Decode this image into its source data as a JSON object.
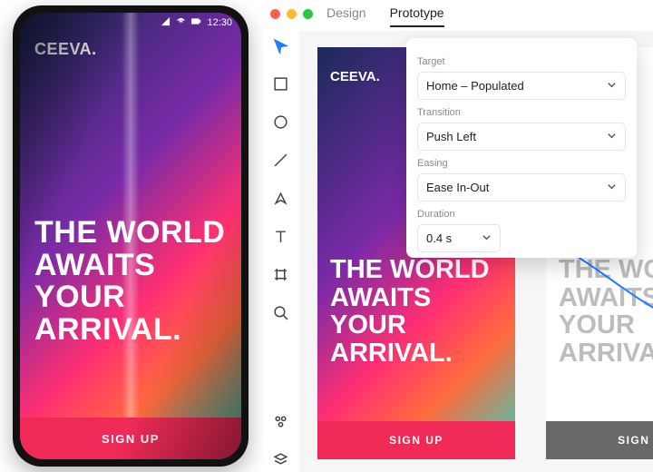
{
  "statusbar": {
    "time": "12:30"
  },
  "app": {
    "brand": "CEEVA.",
    "headline": "THE WORLD AWAITS YOUR ARRIVAL.",
    "cta": "SIGN UP"
  },
  "editor": {
    "tabs": {
      "design": "Design",
      "prototype": "Prototype",
      "active": "prototype"
    }
  },
  "panel": {
    "target_label": "Target",
    "target_value": "Home – Populated",
    "transition_label": "Transition",
    "transition_value": "Push Left",
    "easing_label": "Easing",
    "easing_value": "Ease In-Out",
    "duration_label": "Duration",
    "duration_value": "0.4 s"
  },
  "colors": {
    "accent": "#ef2a57",
    "link": "#1d7dff"
  }
}
